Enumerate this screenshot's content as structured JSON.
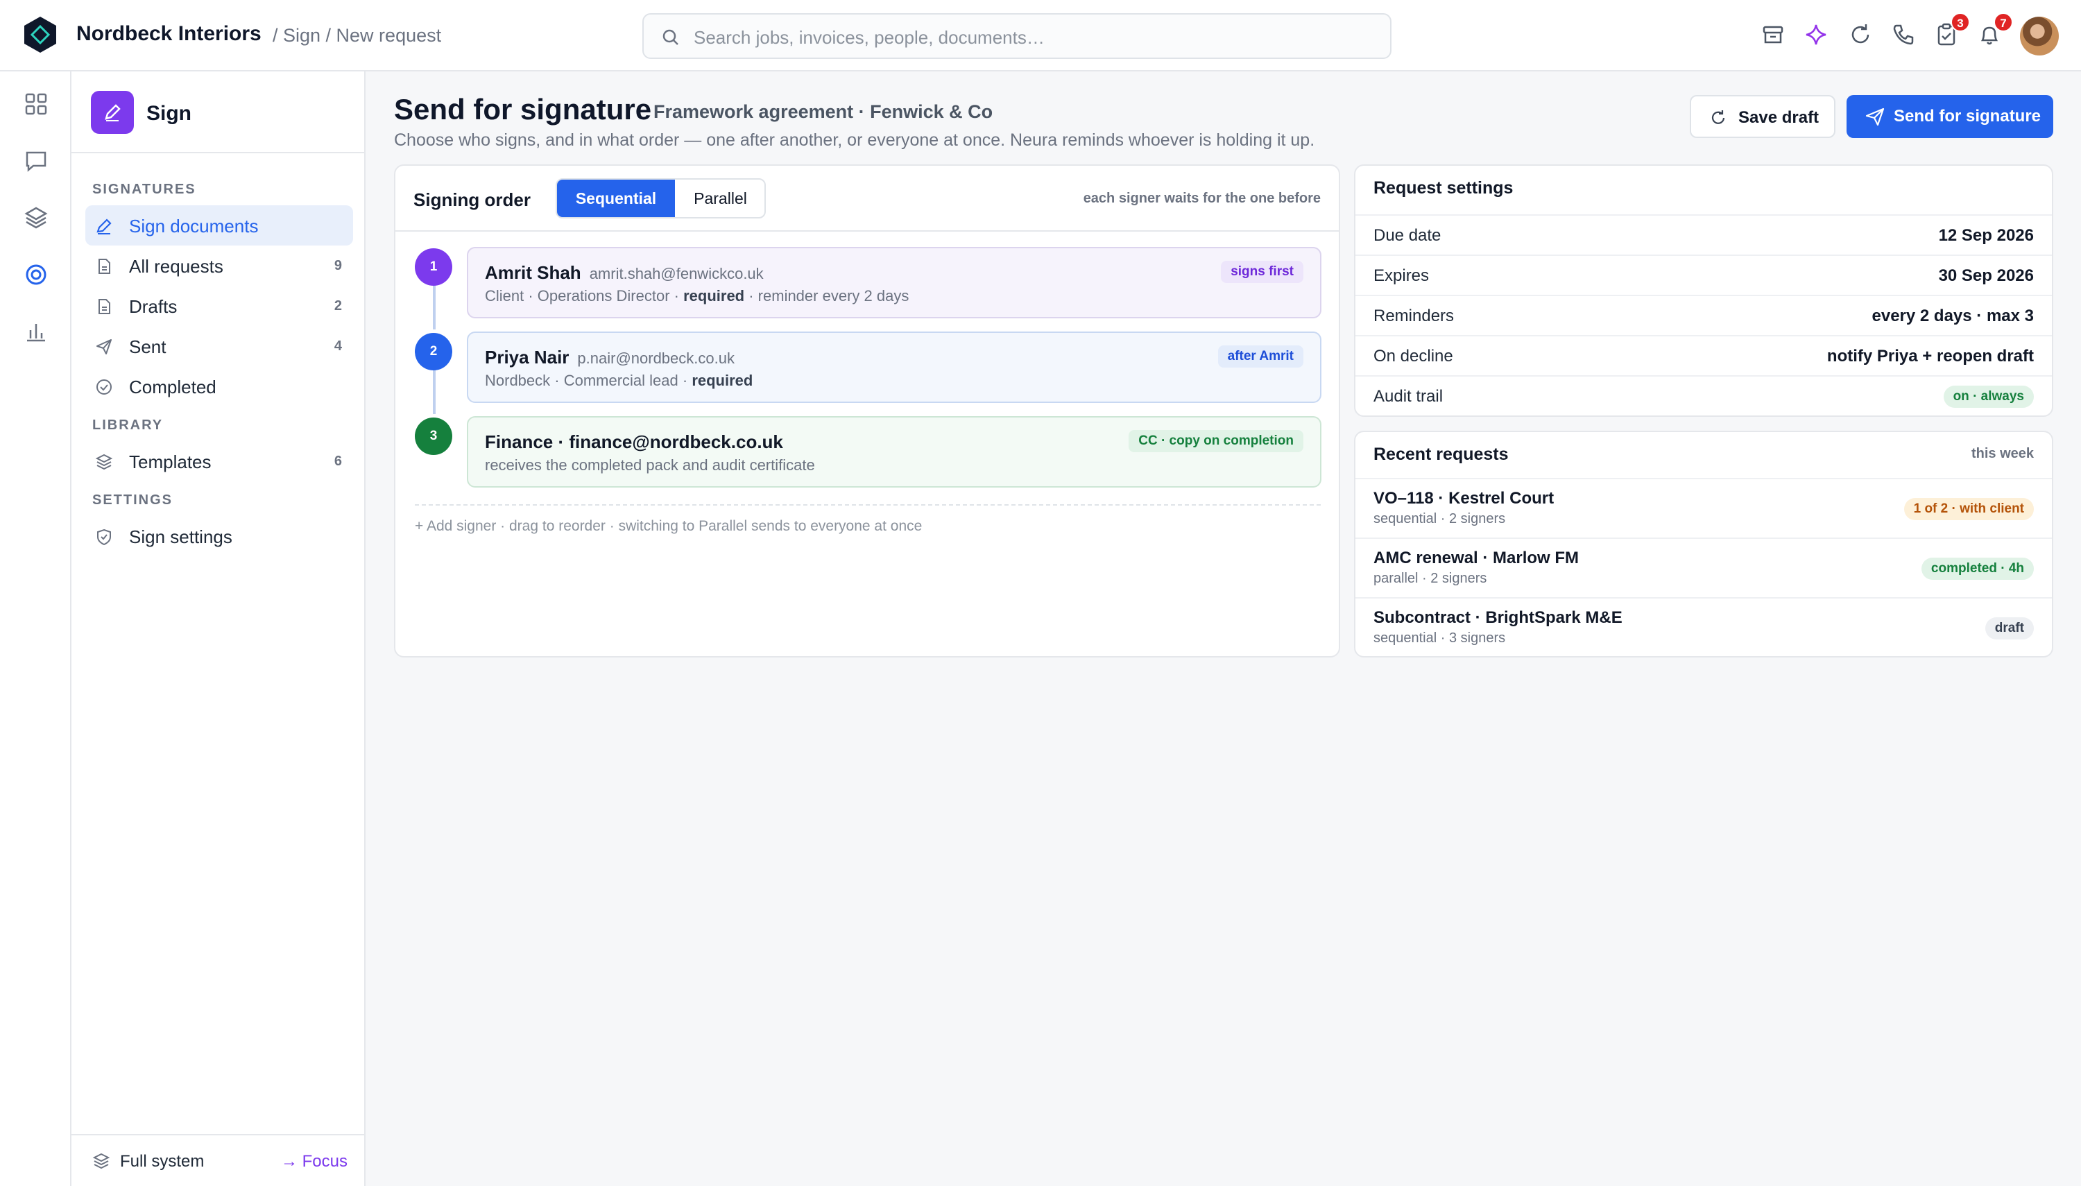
{
  "topbar": {
    "brand": "Nordbeck Interiors",
    "breadcrumb": "/ Sign / New request",
    "search_placeholder": "Search jobs, invoices, people, documents…",
    "tasks_badge": "3",
    "notifications_badge": "7"
  },
  "sidebar": {
    "app_name": "Sign",
    "sections": {
      "signatures": "SIGNATURES",
      "library": "LIBRARY",
      "settings": "SETTINGS"
    },
    "items": [
      {
        "label": "Sign documents",
        "count": "",
        "icon": "pen-icon"
      },
      {
        "label": "All requests",
        "count": "9",
        "icon": "document-icon"
      },
      {
        "label": "Drafts",
        "count": "2",
        "icon": "document-icon"
      },
      {
        "label": "Sent",
        "count": "4",
        "icon": "send-icon"
      },
      {
        "label": "Completed",
        "count": "",
        "icon": "check-circle-icon"
      },
      {
        "label": "Templates",
        "count": "6",
        "icon": "layers-icon"
      },
      {
        "label": "Sign settings",
        "count": "",
        "icon": "shield-icon"
      }
    ],
    "footer": {
      "left": "Full system",
      "right": "→ Focus"
    }
  },
  "header": {
    "title": "Send for signature",
    "subtitle": "Framework agreement · Fenwick & Co",
    "description": "Choose who signs, and in what order — one after another, or everyone at once. Neura reminds whoever is holding it up.",
    "save_label": "Save draft",
    "send_label": "Send for signature"
  },
  "signing": {
    "label": "Signing order",
    "modes": [
      "Sequential",
      "Parallel"
    ],
    "selected_mode": "Sequential",
    "note": "each signer waits for the one before",
    "signers": [
      {
        "step": "1",
        "name": "Amrit Shah",
        "email": "amrit.shah@fenwickco.uk",
        "sub_prefix": "Client · Operations Director · ",
        "sub_bold": "required",
        "sub_suffix": " · reminder every 2 days",
        "tag": "signs first"
      },
      {
        "step": "2",
        "name": "Priya Nair",
        "email": "p.nair@nordbeck.co.uk",
        "sub_prefix": "Nordbeck · Commercial lead · ",
        "sub_bold": "required",
        "sub_suffix": "",
        "tag": "after Amrit"
      },
      {
        "step": "3",
        "name": "Finance · finance@nordbeck.co.uk",
        "email": "",
        "sub_prefix": "receives the completed pack and audit certificate",
        "sub_bold": "",
        "sub_suffix": "",
        "tag": "CC · copy on completion"
      }
    ],
    "footer": "+ Add signer  ·  drag to reorder  ·  switching to Parallel sends to everyone at once"
  },
  "settings": {
    "title": "Request settings",
    "rows": [
      {
        "key": "Due date",
        "value": "12 Sep 2026"
      },
      {
        "key": "Expires",
        "value": "30 Sep 2026"
      },
      {
        "key": "Reminders",
        "value": "every 2 days · max 3"
      },
      {
        "key": "On decline",
        "value": "notify Priya + reopen draft"
      },
      {
        "key": "Audit trail",
        "value": "on · always"
      }
    ]
  },
  "recent": {
    "title": "Recent requests",
    "aside": "this week",
    "rows": [
      {
        "title": "VO–118 · Kestrel Court",
        "sub": "sequential · 2 signers",
        "status": "1 of 2 · with client"
      },
      {
        "title": "AMC renewal · Marlow FM",
        "sub": "parallel · 2 signers",
        "status": "completed · 4h"
      },
      {
        "title": "Subcontract · BrightSpark M&E",
        "sub": "sequential · 3 signers",
        "status": "draft"
      }
    ]
  },
  "colors": {
    "primary": "#2563eb",
    "accent": "#7c3aed",
    "success": "#15803d",
    "warning_bg": "#fdf0d8"
  }
}
